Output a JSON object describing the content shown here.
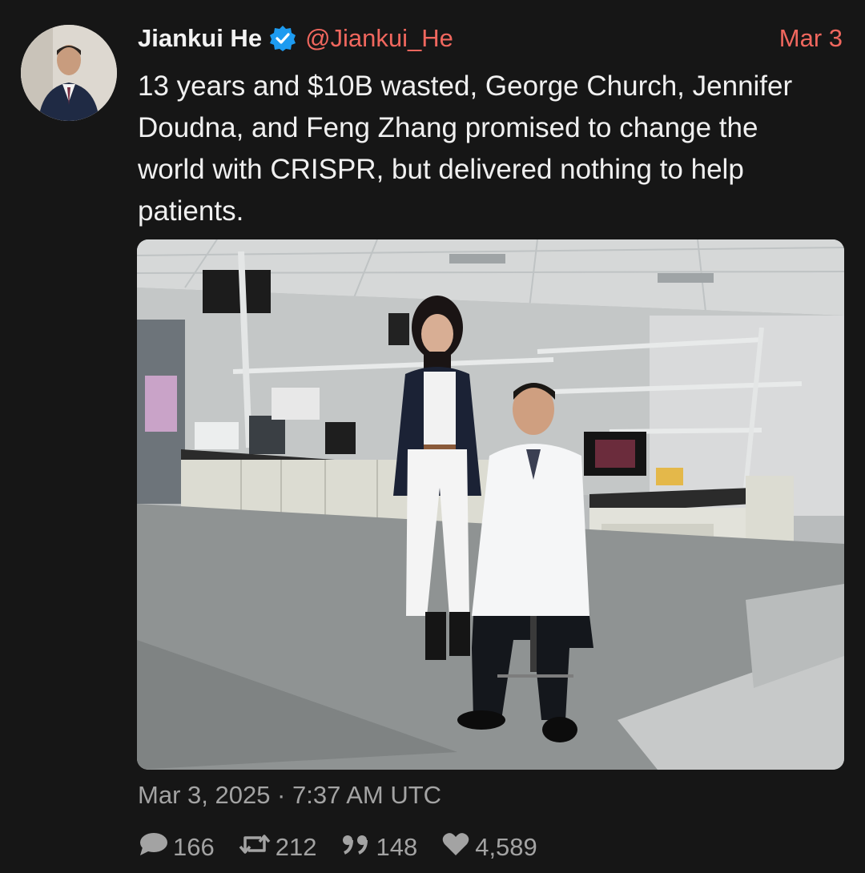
{
  "author": {
    "display_name": "Jiankui He",
    "handle": "@Jiankui_He",
    "verified": true,
    "verified_icon": "verified-badge-icon",
    "avatar_icon": "profile-photo"
  },
  "date_short": "Mar 3",
  "text": "13 years and $10B wasted, George Church, Jennifer Doudna, and Feng Zhang promised to change the world with CRISPR, but delivered nothing to help patients.",
  "timestamp": "Mar 3, 2025 · 7:37 AM UTC",
  "stats": {
    "replies": "166",
    "retweets": "212",
    "quotes": "148",
    "likes": "4,589"
  },
  "colors": {
    "background": "#161616",
    "accent": "#f0675e",
    "muted": "#a3a3a3",
    "verified": "#1d9bf0"
  }
}
